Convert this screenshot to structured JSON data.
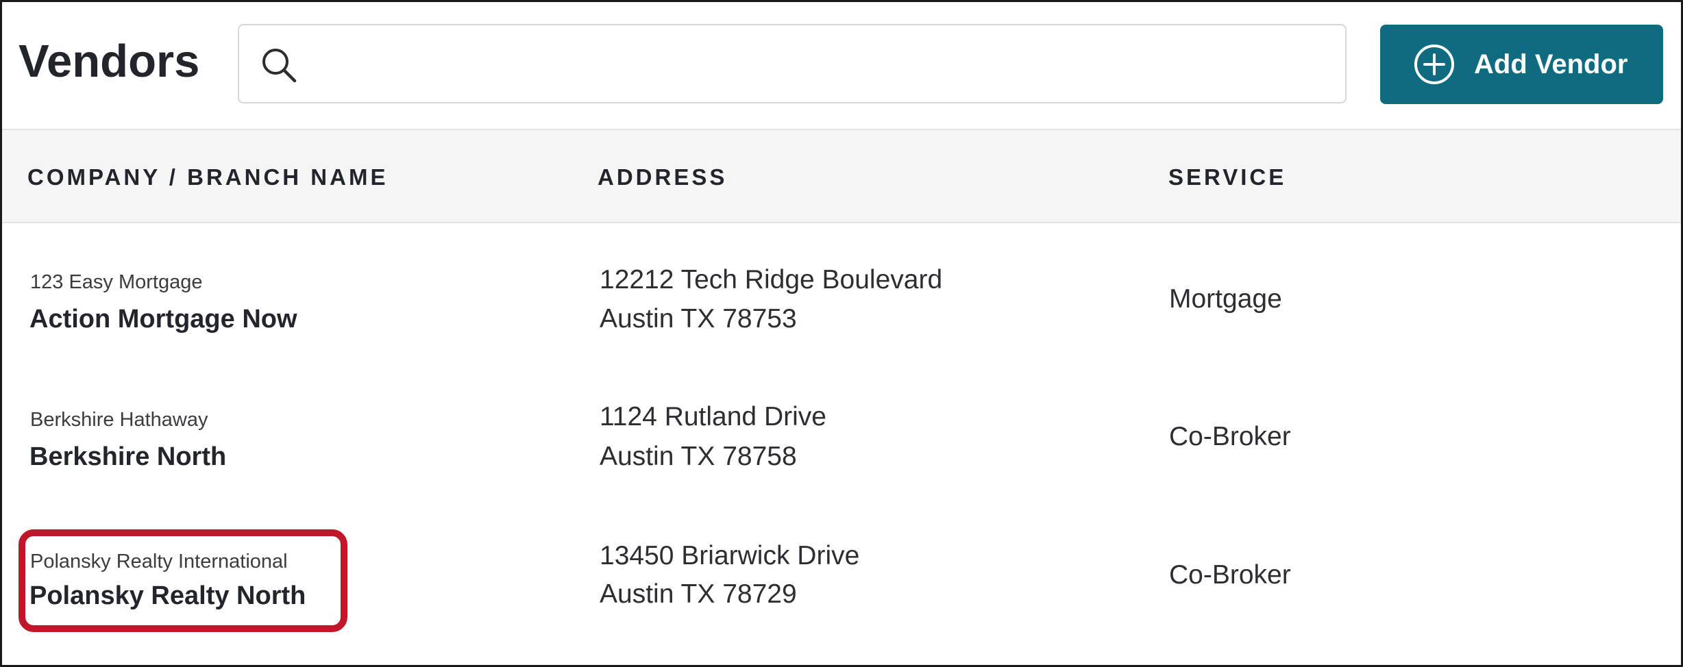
{
  "header": {
    "title": "Vendors",
    "search": {
      "placeholder": "",
      "value": "",
      "icon": "search-icon"
    },
    "add_button": {
      "label": "Add Vendor",
      "icon": "plus-circle-icon"
    }
  },
  "table": {
    "columns": [
      "COMPANY / BRANCH NAME",
      "ADDRESS",
      "SERVICE"
    ],
    "rows": [
      {
        "company": "123 Easy Mortgage",
        "branch": "Action Mortgage Now",
        "address_line1": "12212 Tech Ridge Boulevard",
        "address_line2": "Austin TX 78753",
        "service": "Mortgage"
      },
      {
        "company": "Berkshire Hathaway",
        "branch": "Berkshire North",
        "address_line1": "1124 Rutland Drive",
        "address_line2": "Austin TX 78758",
        "service": "Co-Broker"
      },
      {
        "company": "Polansky Realty International",
        "branch": "Polansky Realty North",
        "address_line1": "13450 Briarwick Drive",
        "address_line2": "Austin TX 78729",
        "service": "Co-Broker"
      }
    ]
  },
  "colors": {
    "accent": "#0e6b80",
    "highlight": "#c0172a",
    "header_bg": "#f5f5f5",
    "text": "#22252b"
  }
}
